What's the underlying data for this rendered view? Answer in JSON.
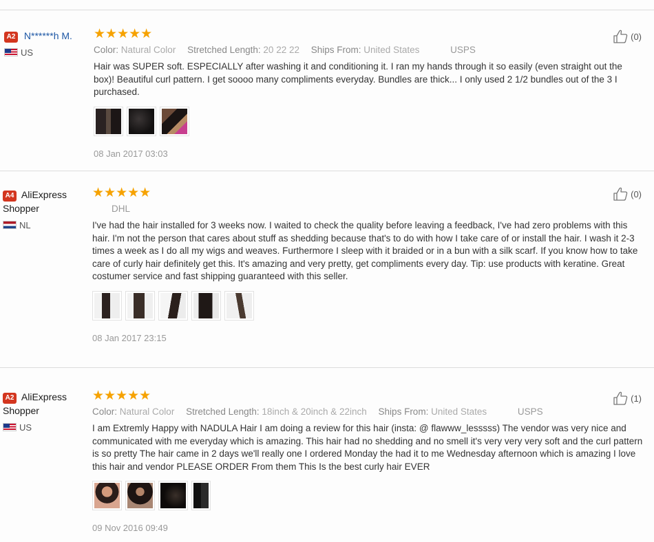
{
  "reviews": [
    {
      "badge": "A2",
      "name": "N******h M.",
      "country": "US",
      "stars": "★★★★★",
      "attrs": {
        "color_label": "Color:",
        "color": "Natural Color",
        "length_label": "Stretched Length:",
        "length": "20 22 22",
        "ships_label": "Ships From:",
        "ships": "United States",
        "shipping": "USPS"
      },
      "text": "Hair was SUPER soft. ESPECIALLY after washing it and conditioning it. I ran my hands through it so easily (even straight out the box)! Beautiful curl pattern. I get soooo many compliments everyday. Bundles are thick... I only used 2 1/2 bundles out of the 3 I purchased.",
      "date": "08 Jan 2017 03:03",
      "likes": "(0)"
    },
    {
      "badge": "A4",
      "name": "AliExpress Shopper",
      "country": "NL",
      "stars": "★★★★★",
      "shipping": "DHL",
      "text": "I've had the hair installed for 3 weeks now. I waited to check the quality before leaving a feedback, I've had zero problems with this hair. I'm not the person that cares about stuff as shedding because that's to do with how I take care of or install the hair. I wash it 2-3 times a week as I do all my wigs and weaves. Furthermore I sleep with it braided or in a bun with a silk scarf. If you know how to take care of curly hair definitely get this. It's amazing and very pretty, get compliments every day. Tip: use products with keratine. Great costumer service and fast shipping guaranteed with this seller.",
      "date": "08 Jan 2017 23:15",
      "likes": "(0)"
    },
    {
      "badge": "A2",
      "name": "AliExpress Shopper",
      "country": "US",
      "stars": "★★★★★",
      "attrs": {
        "color_label": "Color:",
        "color": "Natural Color",
        "length_label": "Stretched Length:",
        "length": "18inch & 20inch & 22inch",
        "ships_label": "Ships From:",
        "ships": "United States",
        "shipping": "USPS"
      },
      "text": "I am Extremly Happy with NADULA Hair I am doing a review for this hair (insta: @ flawww_lesssss) The vendor was very nice and communicated with me everyday which is amazing. This hair had no shedding and no smell it's very very very soft and the curl pattern is so pretty The hair came in 2 days we'll really one I ordered Monday the had it to me Wednesday afternoon which is amazing I love this hair and vendor PLEASE ORDER From them This Is the best curly hair EVER",
      "date": "09 Nov 2016 09:49",
      "likes": "(1)"
    }
  ],
  "icons": {
    "like": "thumbs-up-icon",
    "star": "star-icon"
  },
  "colors": {
    "badge": "#d3361f",
    "stars": "#f6a200",
    "masked_name": "#1d57a5"
  }
}
